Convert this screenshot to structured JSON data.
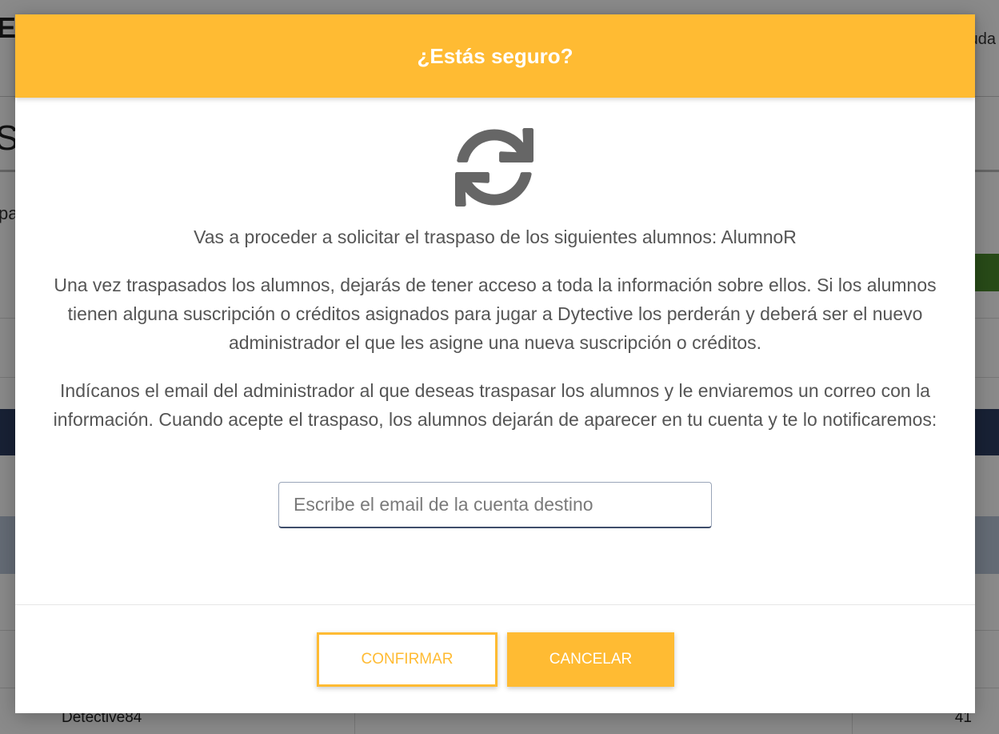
{
  "background": {
    "logo_fragment": "E",
    "header_text_fragment": "uda",
    "title_fragment": "S",
    "text_fragment": "pa",
    "table_row": {
      "name": "Detective84",
      "value": "41"
    }
  },
  "modal": {
    "title": "¿Estás seguro?",
    "icon": "sync-icon",
    "message_1": "Vas a proceder a solicitar el traspaso de los siguientes alumnos: AlumnoR",
    "message_2": "Una vez traspasados los alumnos, dejarás de tener acceso a toda la información sobre ellos. Si los alumnos tienen alguna suscripción o créditos asignados para jugar a Dytective los perderán y deberá ser el nuevo administrador el que les asigne una nueva suscripción o créditos.",
    "message_3": "Indícanos el email del administrador al que deseas traspasar los alumnos y le enviaremos un correo con la información. Cuando acepte el traspaso, los alumnos dejarán de aparecer en tu cuenta y te lo notificaremos:",
    "email_input": {
      "value": "",
      "placeholder": "Escribe el email de la cuenta destino"
    },
    "confirm_label": "Confirmar",
    "cancel_label": "Cancelar"
  },
  "colors": {
    "accent": "#ffbb33",
    "icon": "#666666",
    "overlay": "rgba(0,0,0,0.46)"
  }
}
